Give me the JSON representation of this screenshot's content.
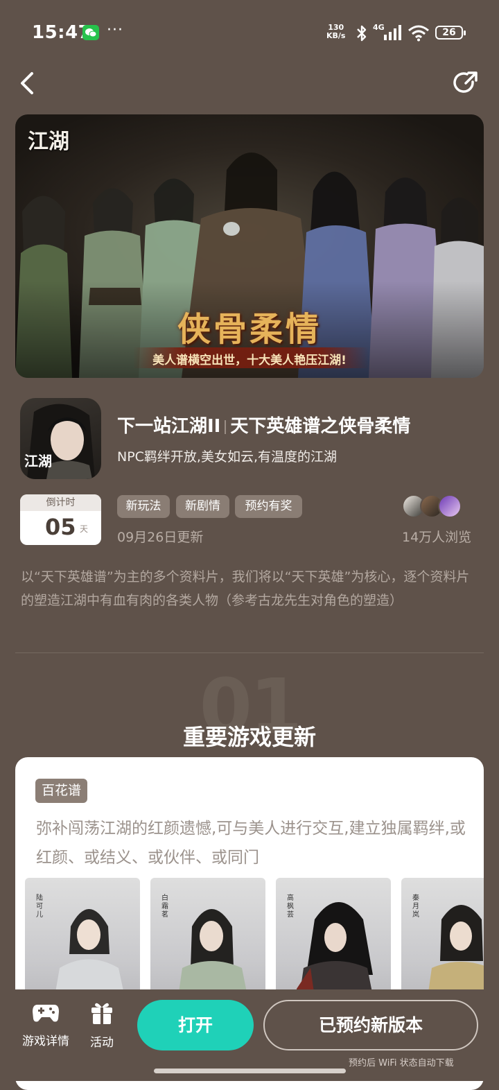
{
  "status_bar": {
    "time": "15:47",
    "more": "···",
    "net_speed_value": "130",
    "net_speed_unit": "KB/s",
    "network": "4G",
    "battery": "26"
  },
  "banner": {
    "logo": "江湖",
    "title": "侠骨柔情",
    "subtitle": "美人谱横空出世，十大美人艳压江湖!"
  },
  "game": {
    "icon_text": "江湖",
    "title_main": "下一站江湖II",
    "title_sub": "天下英雄谱之侠骨柔情",
    "description": "NPC羁绊开放,美女如云,有温度的江湖",
    "countdown_label": "倒计时",
    "countdown_value": "05",
    "countdown_unit": "天",
    "tags": [
      "新玩法",
      "新剧情",
      "预约有奖"
    ],
    "update_date": "09月26日更新",
    "views": "14万人浏览",
    "intro": "以“天下英雄谱”为主的多个资料片，我们将以“天下英雄”为核心，逐个资料片的塑造江湖中有血有肉的各类人物（参考古龙先生对角色的塑造）"
  },
  "section": {
    "number": "01",
    "title": "重要游戏更新"
  },
  "card": {
    "tag": "百花谱",
    "description": "弥补闯荡江湖的红颜遗憾,可与美人进行交互,建立独属羁绊,或红颜、或结义、或伙伴、或同门",
    "characters": [
      "陆可儿",
      "白霜茗",
      "高枫芸",
      "秦月岚"
    ]
  },
  "bottom_bar": {
    "details_label": "游戏详情",
    "activity_label": "活动",
    "open_label": "打开",
    "reserve_label": "已预约新版本",
    "reserve_hint": "预约后 WiFi 状态自动下载"
  },
  "colors": {
    "background": "#5f524a",
    "accent": "#1fd1b8",
    "tag_bg": "#8a7d74"
  }
}
